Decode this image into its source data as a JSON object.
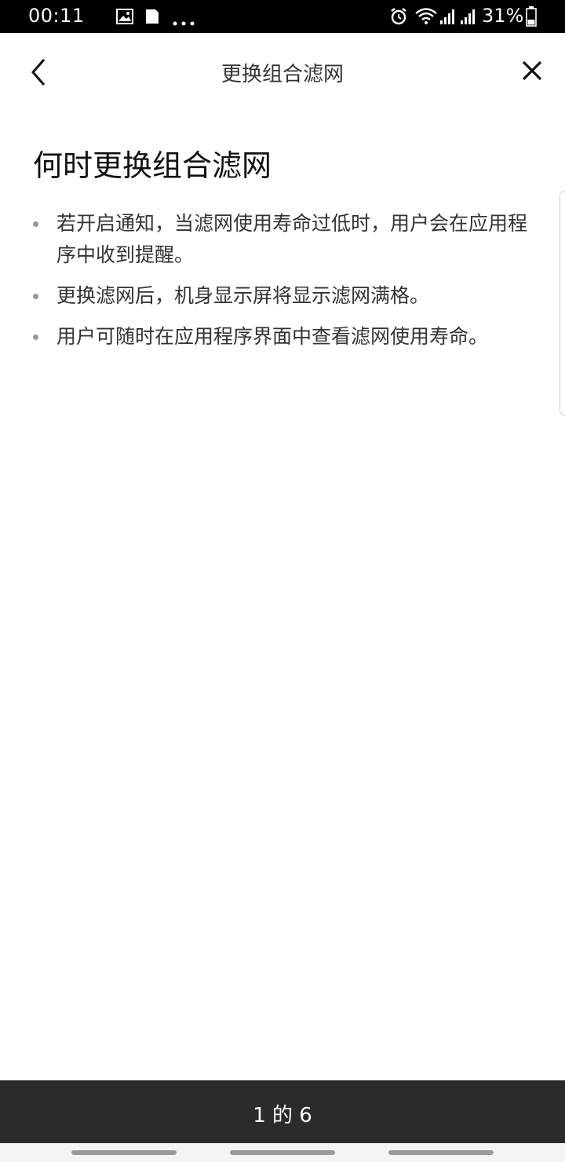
{
  "status_bar": {
    "time": "00:11",
    "battery": "31%",
    "icons": [
      "image-icon",
      "sim-card-icon",
      "more-dots-icon",
      "alarm-icon",
      "wifi-icon",
      "signal-icon",
      "signal-icon",
      "battery-icon"
    ]
  },
  "header": {
    "title": "更换组合滤网",
    "back_icon": "chevron-left-icon",
    "close_icon": "close-icon"
  },
  "content": {
    "title": "何时更换组合滤网",
    "bullets": [
      "若开启通知，当滤网使用寿命过低时，用户会在应用程序中收到提醒。",
      "更换滤网后，机身显示屏将显示滤网满格。",
      "用户可随时在应用程序界面中查看滤网使用寿命。"
    ]
  },
  "footer": {
    "page_indicator": "1 的 6"
  },
  "colors": {
    "status_bar_bg": "#000000",
    "footer_bg": "#2b2b2b",
    "page_bg": "#ffffff"
  }
}
